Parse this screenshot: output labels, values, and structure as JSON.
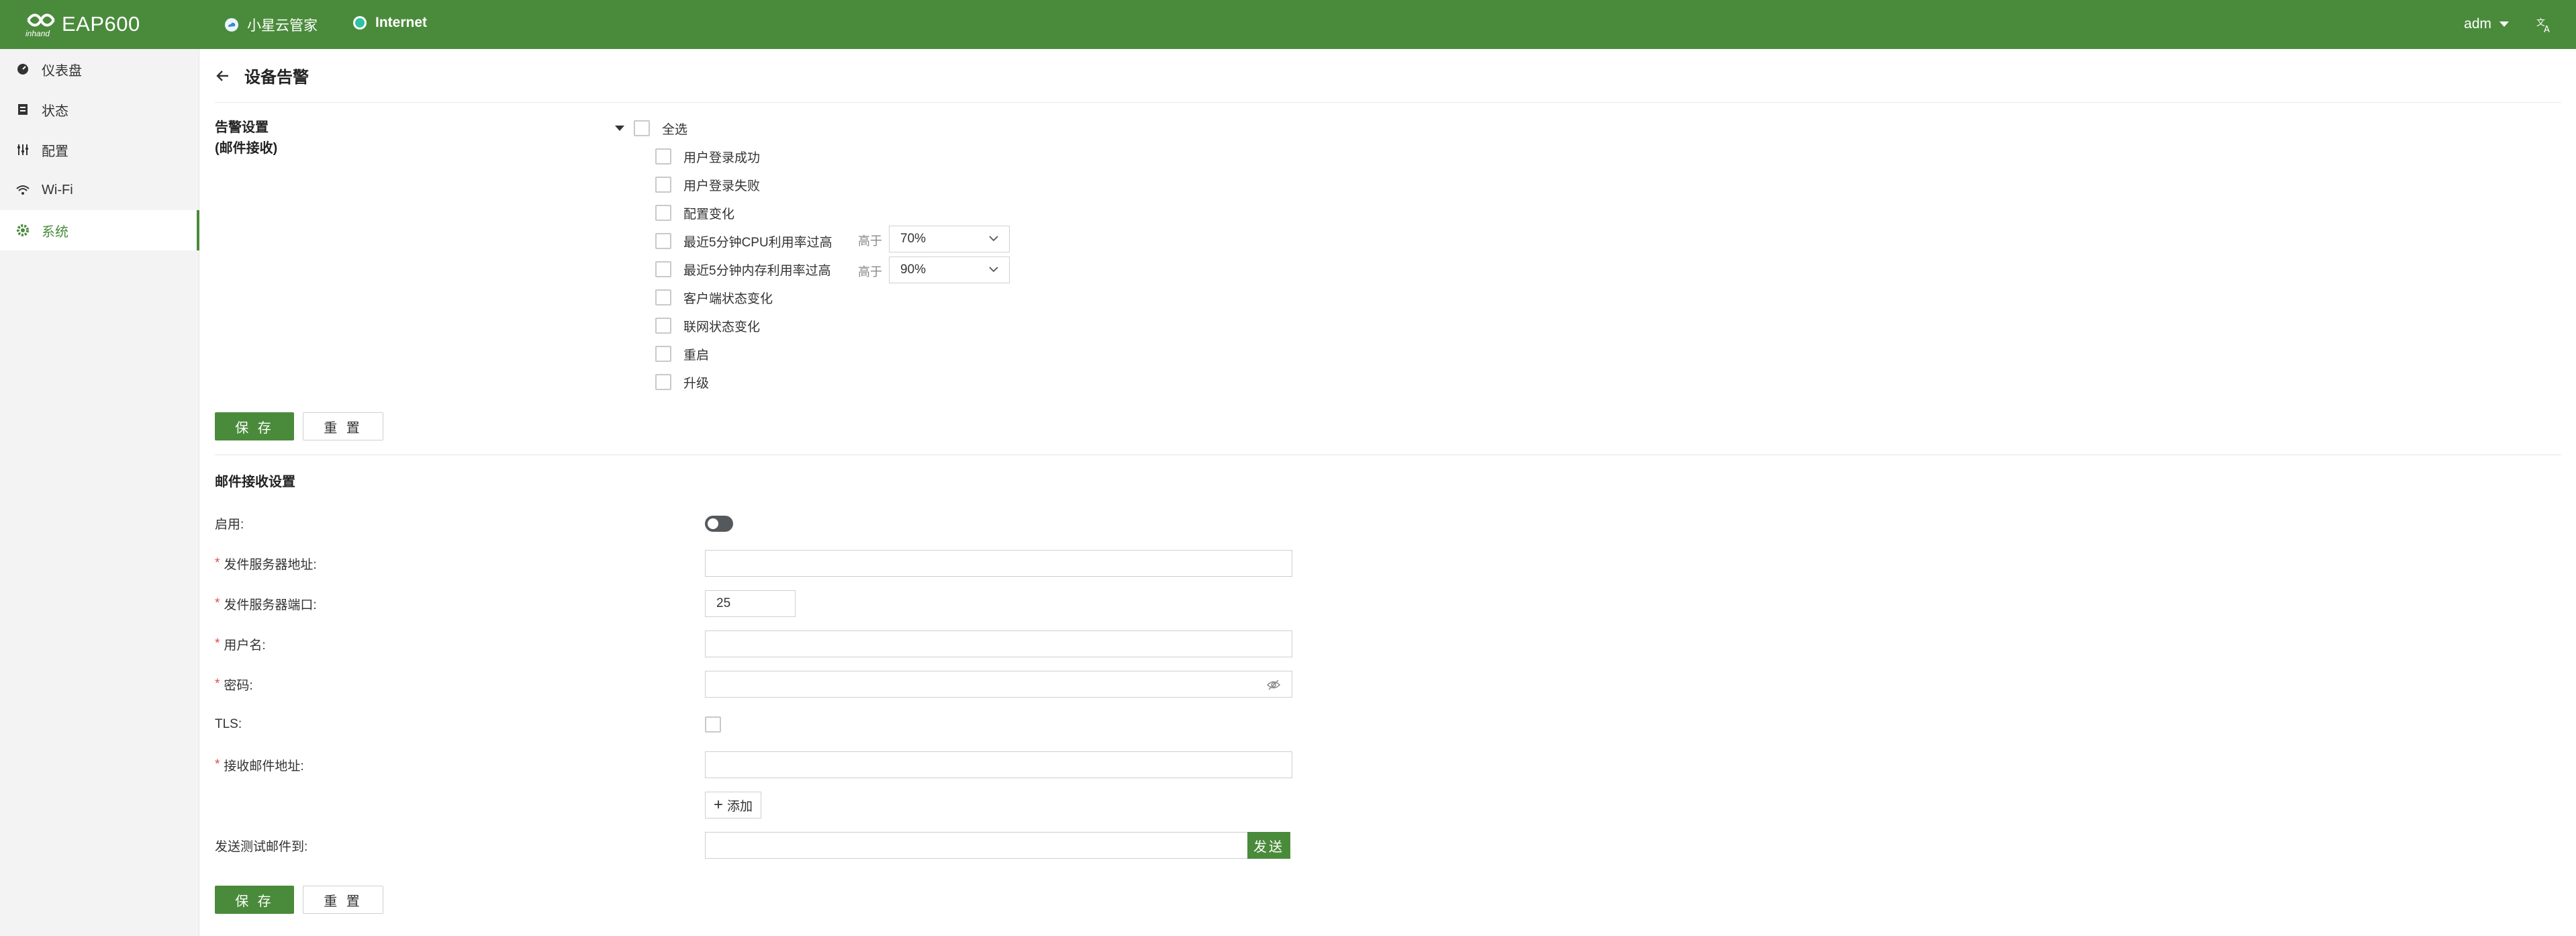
{
  "header": {
    "brand_text": "inhand",
    "model": "EAP600",
    "cloud_label": "小星云管家",
    "network_label": "Internet",
    "user": "adm"
  },
  "sidebar": {
    "items": [
      {
        "label": "仪表盘",
        "icon": "dashboard-icon"
      },
      {
        "label": "状态",
        "icon": "status-icon"
      },
      {
        "label": "配置",
        "icon": "config-icon"
      },
      {
        "label": "Wi-Fi",
        "icon": "wifi-icon"
      },
      {
        "label": "系统",
        "icon": "gear-icon",
        "active": true
      }
    ]
  },
  "page": {
    "title": "设备告警"
  },
  "alarm": {
    "section_label_line1": "告警设置",
    "section_label_line2": "(邮件接收)",
    "select_all": "全选",
    "higher_label": "高于",
    "options": [
      {
        "label": "用户登录成功",
        "checked": false
      },
      {
        "label": "用户登录失败",
        "checked": false
      },
      {
        "label": "配置变化",
        "checked": false
      },
      {
        "label": "最近5分钟CPU利用率过高",
        "checked": false,
        "threshold": "70%"
      },
      {
        "label": "最近5分钟内存利用率过高",
        "checked": false,
        "threshold": "90%"
      },
      {
        "label": "客户端状态变化",
        "checked": false
      },
      {
        "label": "联网状态变化",
        "checked": false
      },
      {
        "label": "重启",
        "checked": false
      },
      {
        "label": "升级",
        "checked": false
      }
    ],
    "save_label": "保 存",
    "reset_label": "重 置"
  },
  "mail": {
    "section_title": "邮件接收设置",
    "enable_label": "启用:",
    "enable_on": false,
    "server_label": "发件服务器地址:",
    "server_value": "",
    "port_label": "发件服务器端口:",
    "port_value": "25",
    "username_label": "用户名:",
    "username_value": "",
    "password_label": "密码:",
    "password_value": "",
    "tls_label": "TLS:",
    "tls_checked": false,
    "recipient_label": "接收邮件地址:",
    "recipient_value": "",
    "add_label": "添加",
    "test_label": "发送测试邮件到:",
    "test_value": "",
    "send_label": "发送",
    "save_label": "保 存",
    "reset_label": "重 置"
  },
  "colors": {
    "primary": "#4a8b3b",
    "required": "#e24a4a"
  }
}
